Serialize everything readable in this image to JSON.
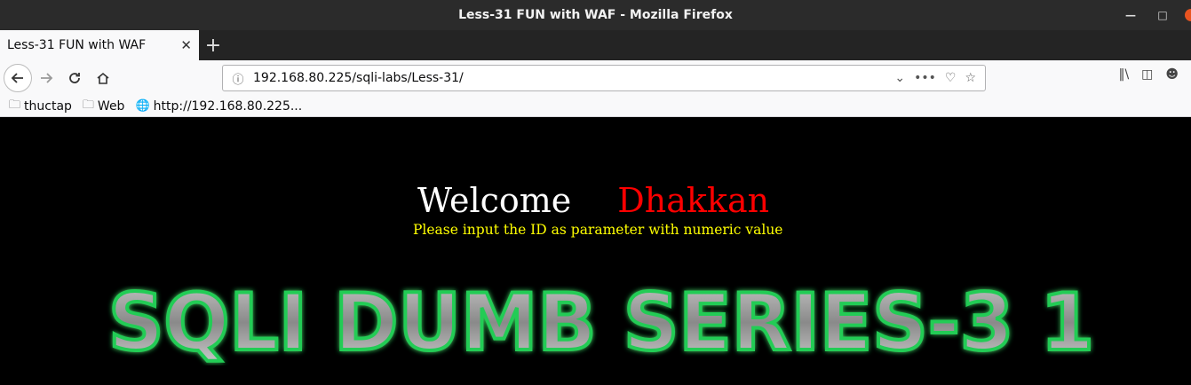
{
  "window": {
    "title": "Less-31 FUN with WAF - Mozilla Firefox"
  },
  "tabs": [
    {
      "label": "Less-31 FUN with WAF"
    }
  ],
  "nav": {
    "url": "192.168.80.225/sqli-labs/Less-31/"
  },
  "bookmarks": [
    {
      "label": "thuctap",
      "icon": "folder-icon"
    },
    {
      "label": "Web",
      "icon": "folder-icon"
    },
    {
      "label": "http://192.168.80.225...",
      "icon": "globe-icon"
    }
  ],
  "page": {
    "welcome": "Welcome",
    "name": "Dhakkan",
    "prompt": "Please input the ID as parameter with numeric value",
    "banner": "SQLI DUMB SERIES-3 1"
  },
  "colors": {
    "welcome": "#ffffff",
    "name": "#ff0000",
    "prompt": "#ffff00",
    "banner_glow": "#22cc55"
  }
}
